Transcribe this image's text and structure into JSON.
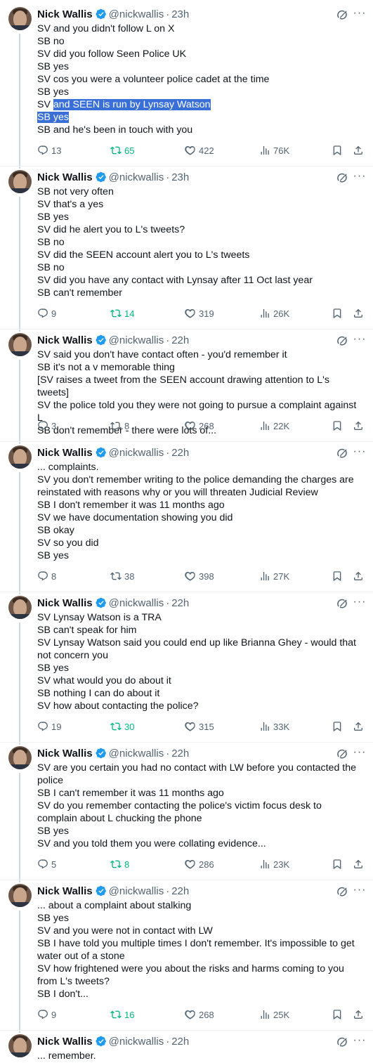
{
  "colors": {
    "accent": "#1d9bf0",
    "retweet_active": "#00ba7c",
    "highlight": "#3a6fd8"
  },
  "tweets": [
    {
      "name": "Nick Wallis",
      "handle": "@nickwallis",
      "time": "23h",
      "lines": [
        "SV and you didn't follow L on X",
        "SB no",
        "SV did you follow Seen Police UK",
        "SB yes",
        "SV cos you were a volunteer police cadet at the time",
        "SB yes",
        "SV and SEEN is run by Lynsay Watson",
        "SB yes",
        "SB and he's been in touch with you"
      ],
      "replies": "13",
      "retweets": "65",
      "likes": "422",
      "views": "76K",
      "retweeted": true
    },
    {
      "name": "Nick Wallis",
      "handle": "@nickwallis",
      "time": "23h",
      "lines": [
        "SB not very often",
        "SV that's a yes",
        "SB yes",
        "SV did he alert you to L's tweets?",
        "SB no",
        "SV did the SEEN account alert you to L's tweets",
        "SB no",
        "SV did you have any contact with Lynsay after 11 Oct last year",
        "SB can't remember"
      ],
      "replies": "9",
      "retweets": "14",
      "likes": "319",
      "views": "26K",
      "retweeted": true
    },
    {
      "name": "Nick Wallis",
      "handle": "@nickwallis",
      "time": "22h",
      "lines": [
        "SV said you don't have contact often - you'd remember it",
        "SB it's not a v memorable thing",
        "[SV raises a tweet from the SEEN account drawing attention to L's tweets]",
        "SV the police told you they were not going to pursue a complaint against L",
        "SB don't remember - there were lots of..."
      ],
      "replies": "3",
      "retweets": "8",
      "likes": "268",
      "views": "22K",
      "retweeted": false
    },
    {
      "name": "Nick Wallis",
      "handle": "@nickwallis",
      "time": "22h",
      "lines": [
        "... complaints.",
        "SV you don't remember writing to the police demanding the charges are reinstated with reasons why or you will threaten Judicial Review",
        "SB I don't remember it was 11 months ago",
        "SV we have documentation showing you did",
        "SB okay",
        "SV so you did",
        "SB yes"
      ],
      "replies": "8",
      "retweets": "38",
      "likes": "398",
      "views": "27K",
      "retweeted": false
    },
    {
      "name": "Nick Wallis",
      "handle": "@nickwallis",
      "time": "22h",
      "lines": [
        "SV Lynsay Watson is a TRA",
        "SB can't speak for him",
        "SV Lynsay Watson said you could end up like Brianna Ghey - would that not concern you",
        "SB yes",
        "SV what would you do about it",
        "SB nothing I can do about it",
        "SV how about contacting the police?"
      ],
      "replies": "19",
      "retweets": "30",
      "likes": "315",
      "views": "33K",
      "retweeted": true
    },
    {
      "name": "Nick Wallis",
      "handle": "@nickwallis",
      "time": "22h",
      "lines": [
        "SV are you certain you had no contact with LW before you contacted the police",
        "SB I can't remember it was 11 months ago",
        "SV do you remember contacting the police's victim focus desk to complain about L chucking the phone",
        "SB yes",
        "SV and you told them you were collating evidence..."
      ],
      "replies": "5",
      "retweets": "8",
      "likes": "286",
      "views": "23K",
      "retweeted": true
    },
    {
      "name": "Nick Wallis",
      "handle": "@nickwallis",
      "time": "22h",
      "lines": [
        "... about a complaint about stalking",
        "SB yes",
        "SV and you were not in contact with LW",
        "SB I have told you multiple times I don't remember. It's impossible to get water out of a stone",
        "SV how frightened were you about the risks and harms coming to you from L's tweets?",
        "SB I don't..."
      ],
      "replies": "9",
      "retweets": "16",
      "likes": "268",
      "views": "25K",
      "retweeted": true
    },
    {
      "name": "Nick Wallis",
      "handle": "@nickwallis",
      "time": "22h",
      "lines": [
        "... remember."
      ],
      "replies": "",
      "retweets": "",
      "likes": "",
      "views": "",
      "retweeted": false
    }
  ]
}
